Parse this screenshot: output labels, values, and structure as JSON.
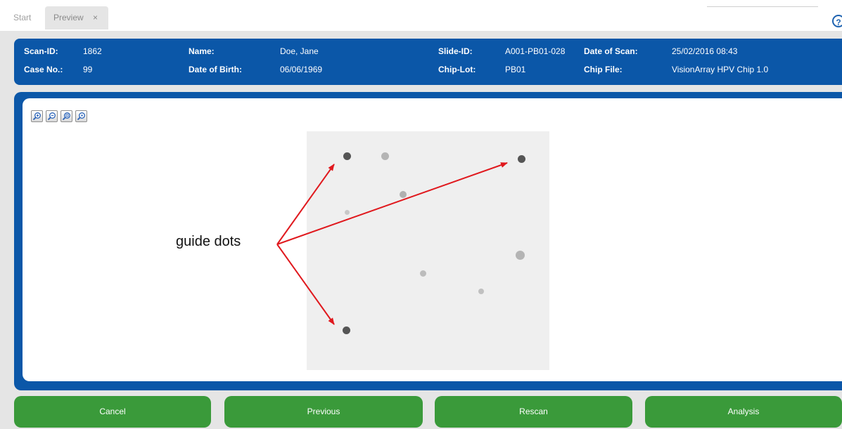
{
  "tabs": {
    "start_label": "Start",
    "preview_label": "Preview",
    "close_glyph": "×"
  },
  "help_icon": "?",
  "scan_info": {
    "scan_id_label": "Scan-ID:",
    "scan_id": "1862",
    "name_label": "Name:",
    "name": "Doe, Jane",
    "slide_id_label": "Slide-ID:",
    "slide_id": "A001-PB01-028",
    "date_of_scan_label": "Date of Scan:",
    "date_of_scan": "25/02/2016 08:43",
    "case_no_label": "Case No.:",
    "case_no": "99",
    "date_of_birth_label": "Date of Birth:",
    "date_of_birth": "06/06/1969",
    "chip_lot_label": "Chip-Lot:",
    "chip_lot": "PB01",
    "chip_file_label": "Chip File:",
    "chip_file": "VisionArray HPV Chip 1.0"
  },
  "zoom_tools": [
    "zoom-in-icon",
    "zoom-out-icon",
    "zoom-fit-icon",
    "zoom-reset-icon"
  ],
  "annotation": {
    "label": "guide dots",
    "color": "#e0191e"
  },
  "buttons": {
    "cancel": "Cancel",
    "previous": "Previous",
    "rescan": "Rescan",
    "analysis": "Analysis"
  },
  "colors": {
    "header_blue": "#0b57a8",
    "button_green": "#3a9a3a"
  }
}
